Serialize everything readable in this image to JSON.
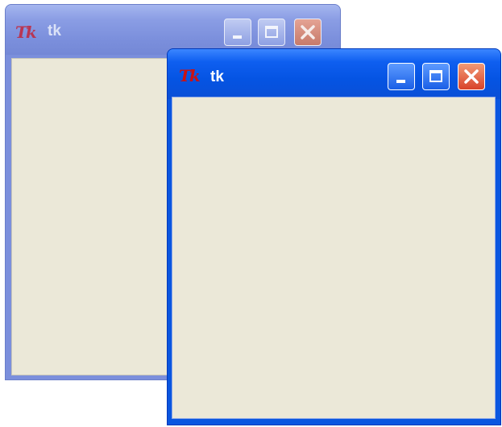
{
  "windows": [
    {
      "title": "tk",
      "icon": "tk-feather-icon",
      "icon_text": "Tk",
      "active": false,
      "buttons": [
        "minimize",
        "maximize",
        "close"
      ]
    },
    {
      "title": "tk",
      "icon": "tk-feather-icon",
      "icon_text": "Tk",
      "active": true,
      "buttons": [
        "minimize",
        "maximize",
        "close"
      ]
    }
  ],
  "colors": {
    "active_titlebar": "#0554e3",
    "inactive_titlebar": "#7b8fdc",
    "client_background": "#ebe8d8",
    "close_button": "#d8432a"
  }
}
